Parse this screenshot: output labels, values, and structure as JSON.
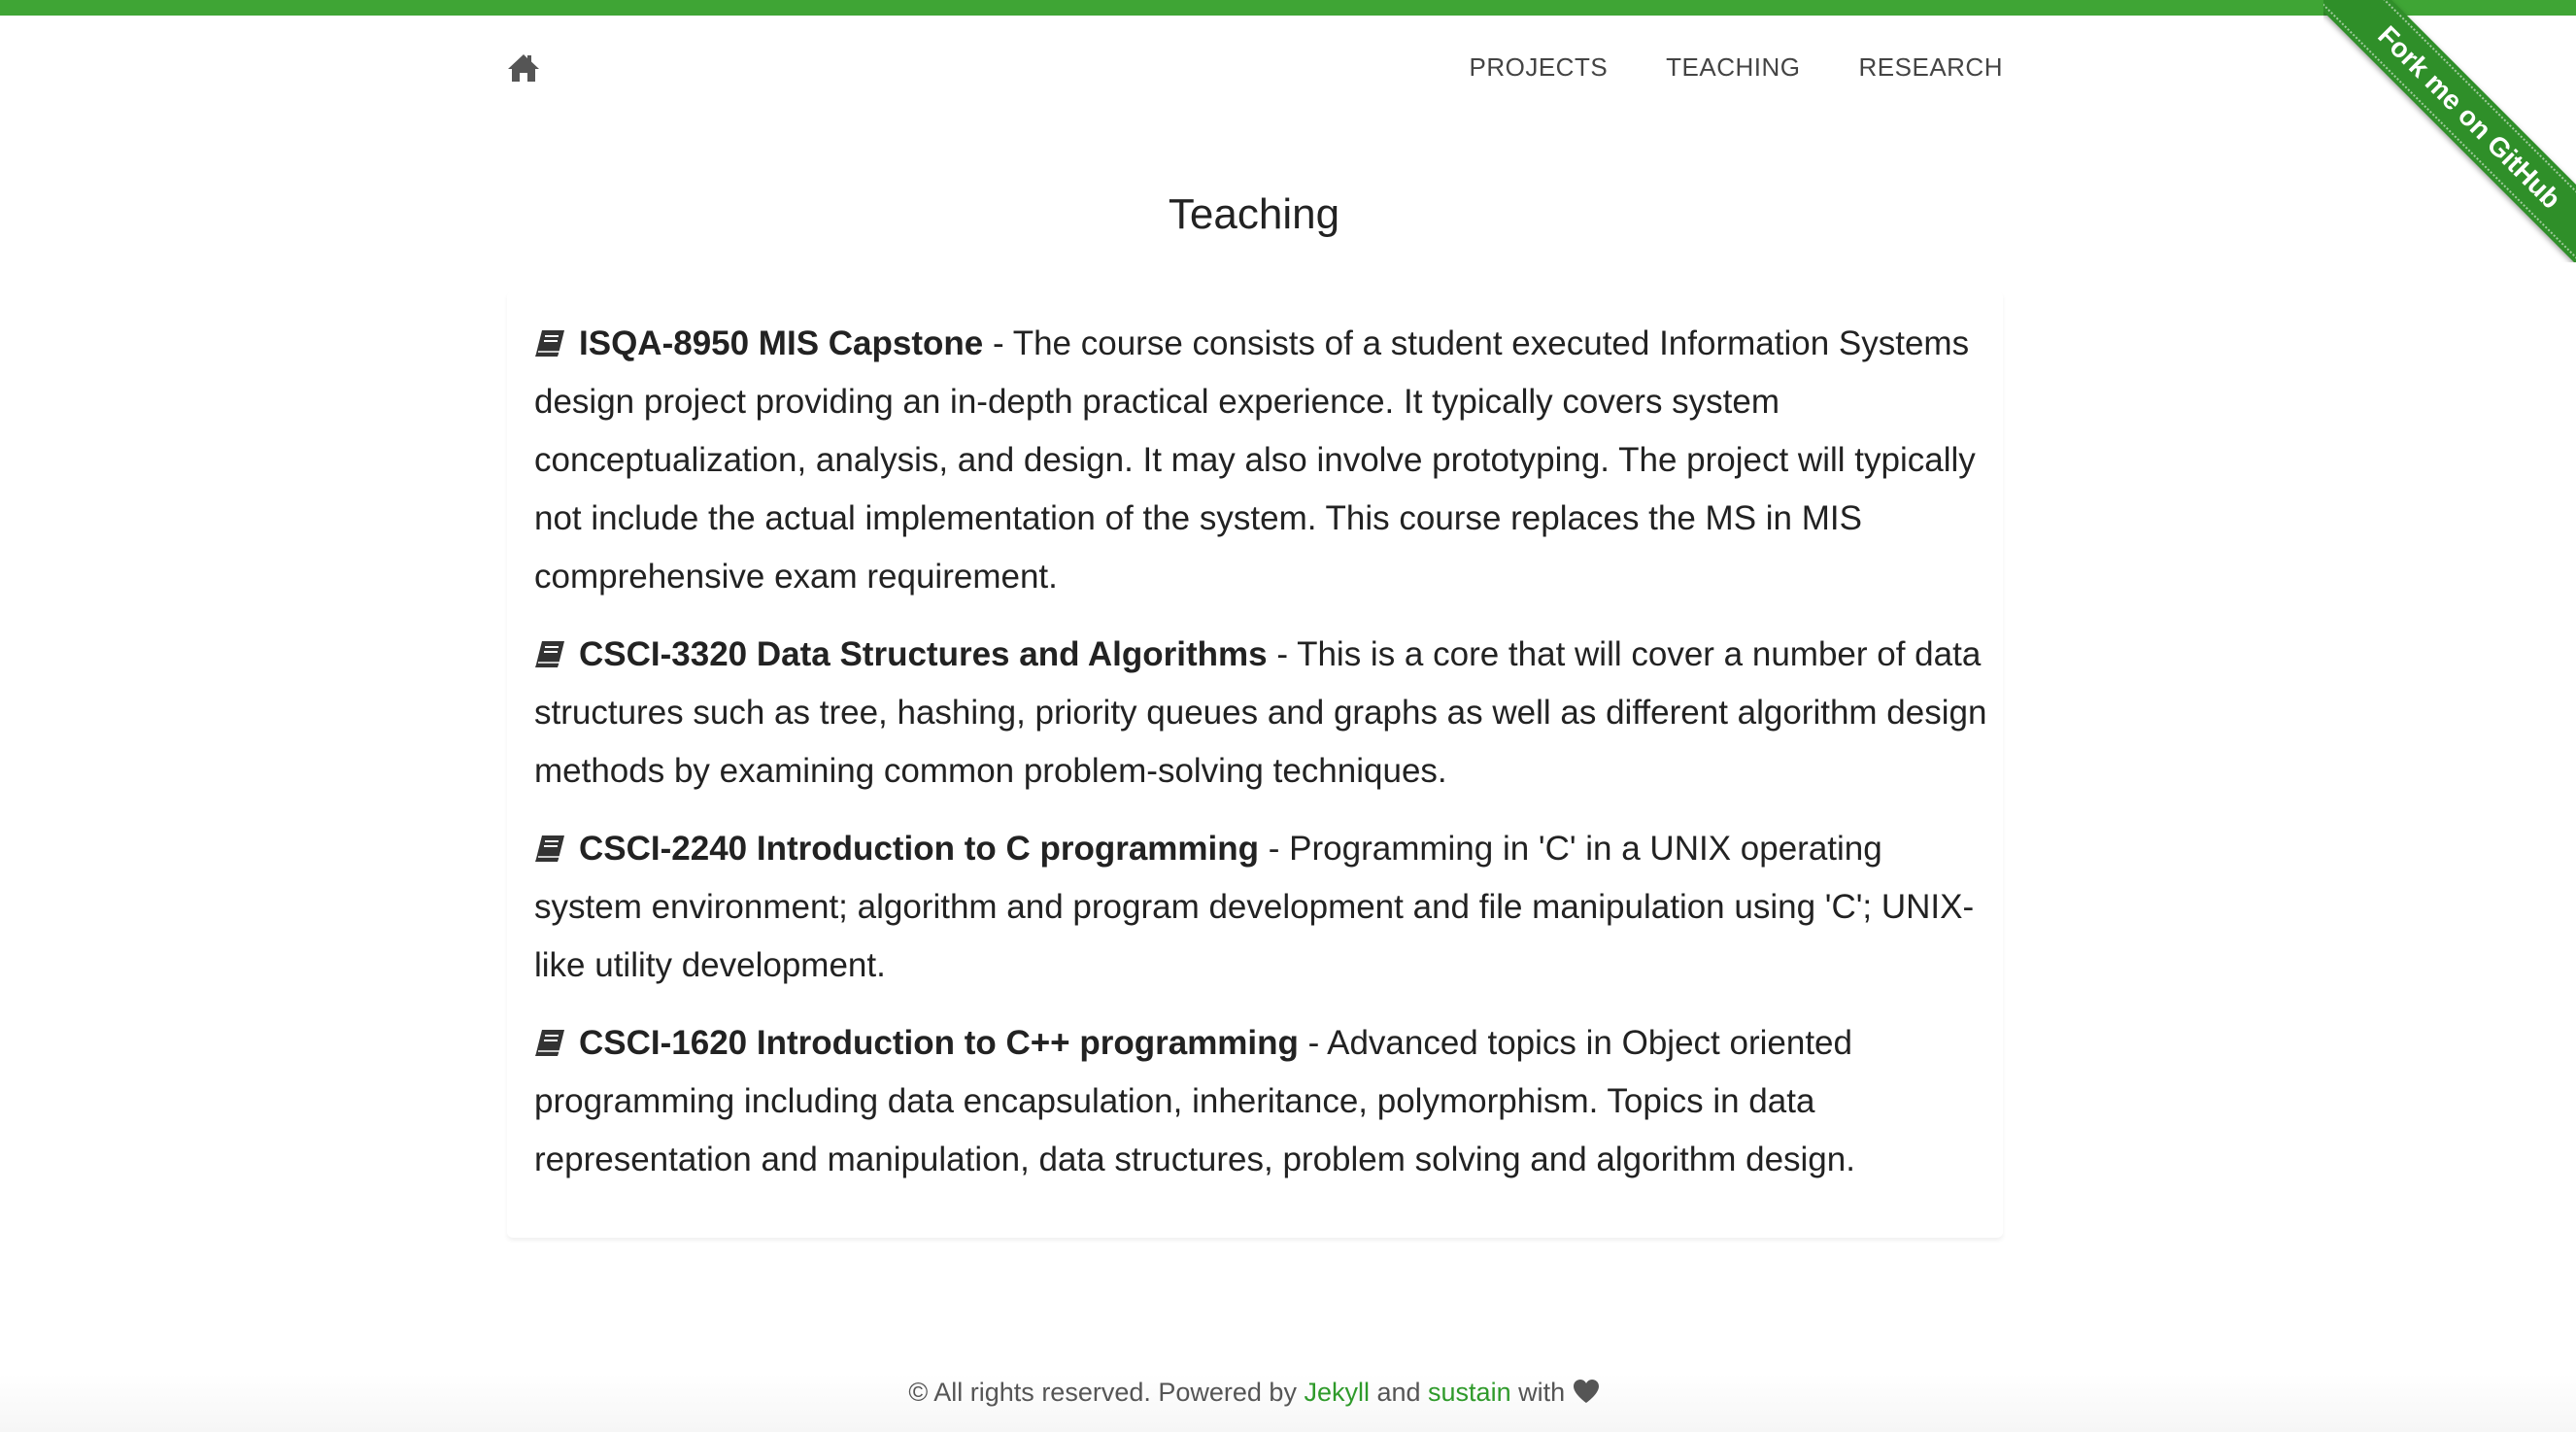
{
  "nav": {
    "home_icon": "home-icon",
    "links": [
      {
        "label": "PROJECTS"
      },
      {
        "label": "TEACHING"
      },
      {
        "label": "RESEARCH"
      }
    ]
  },
  "ribbon": {
    "label": "Fork me on GitHub",
    "color": "#2f8f29"
  },
  "page": {
    "title": "Teaching"
  },
  "courses": [
    {
      "icon": "book-icon",
      "title": "ISQA-8950 MIS Capstone",
      "description": " - The course consists of a student executed Information Systems design project providing an in-depth practical experience. It typically covers system conceptualization, analysis, and design. It may also involve prototyping. The project will typically not include the actual implementation of the system. This course replaces the MS in MIS comprehensive exam requirement."
    },
    {
      "icon": "book-icon",
      "title": "CSCI-3320 Data Structures and Algorithms",
      "description": " - This is a core that will cover a number of data structures such as tree, hashing, priority queues and graphs as well as different algorithm design methods by examining common problem-solving techniques."
    },
    {
      "icon": "book-icon",
      "title": "CSCI-2240 Introduction to C programming",
      "description": " - Programming in 'C' in a UNIX operating system environment; algorithm and program development and file manipulation using 'C'; UNIX-like utility development."
    },
    {
      "icon": "book-icon",
      "title": "CSCI-1620 Introduction to C++ programming",
      "description": " - Advanced topics in Object oriented programming including data encapsulation, inheritance, polymorphism. Topics in data representation and manipulation, data structures, problem solving and algorithm design."
    }
  ],
  "footer": {
    "prefix": "© All rights reserved. Powered by ",
    "jekyll_link": "Jekyll",
    "middle": " and ",
    "sustain_link": "sustain",
    "suffix": " with ",
    "heart_icon": "heart-icon"
  },
  "colors": {
    "accent": "#3fa535",
    "link": "#2e9a2a"
  }
}
